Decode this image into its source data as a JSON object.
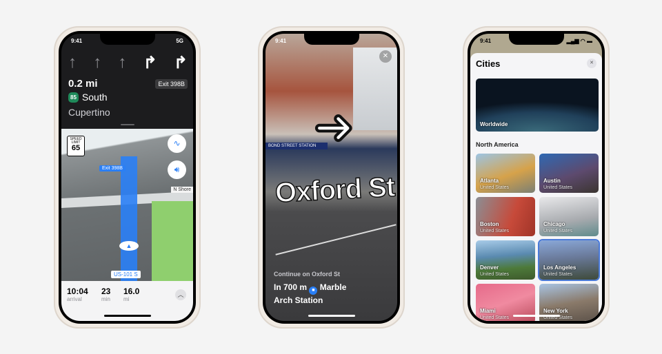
{
  "phone1": {
    "status": {
      "time": "9:41",
      "signal": "5G"
    },
    "lanes": [
      "↑",
      "↑",
      "↑",
      "↱",
      "↱"
    ],
    "distance": "0.2 mi",
    "exit_badge": "Exit 398B",
    "route_shield": "85",
    "direction": "South",
    "destination": "Cupertino",
    "speed_limit": {
      "label1": "SPEED",
      "label2": "LIMIT",
      "value": "65"
    },
    "map_labels": {
      "exit": "Exit 398B",
      "street": "N Shore",
      "highway": "US-101 S"
    },
    "trip": {
      "arrival": "10:04",
      "arrival_label": "arrival",
      "minutes": "23",
      "minutes_label": "min",
      "miles": "16.0",
      "miles_label": "mi"
    },
    "accent": "#2a7ff6"
  },
  "phone2": {
    "status": {
      "time": "9:41"
    },
    "sign": "BOND STREET STATION",
    "ar_street": "Oxford St",
    "instruction": "Continue on Oxford St",
    "line1_a": "In 700 m",
    "line1_b": "Marble",
    "line2": "Arch Station"
  },
  "phone3": {
    "status": {
      "time": "9:41"
    },
    "title": "Cities",
    "featured": "Worldwide",
    "section": "North America",
    "cities": [
      {
        "name": "Atlanta",
        "country": "United States",
        "bg": "linear-gradient(160deg,#9cc4e4,#d6a24a 55%,#7a7f74)"
      },
      {
        "name": "Austin",
        "country": "United States",
        "bg": "linear-gradient(160deg,#2f69b3,#5d4a6e 55%,#3b3530)"
      },
      {
        "name": "Boston",
        "country": "United States",
        "bg": "linear-gradient(110deg,#8b8e94,#c74a3a 60%,#a03428)"
      },
      {
        "name": "Chicago",
        "country": "United States",
        "bg": "linear-gradient(170deg,#e8e8ea,#a7aaae 60%,#5f8b8c)"
      },
      {
        "name": "Denver",
        "country": "United States",
        "bg": "linear-gradient(175deg,#a8cbe8,#5a8ab0 40%,#4d7a3a 70%,#3e5a2c)"
      },
      {
        "name": "Los Angeles",
        "country": "United States",
        "bg": "linear-gradient(175deg,#8aa8d8,#6a7a9a 45%,#3e4a3a)"
      },
      {
        "name": "Miami",
        "country": "United States",
        "bg": "linear-gradient(160deg,#e66a8a,#f08aa0 50%,#b84a5a)"
      },
      {
        "name": "New York",
        "country": "United States",
        "bg": "linear-gradient(170deg,#a8c4e4,#8a7a6a 50%,#5a5048)"
      }
    ],
    "selected": "Los Angeles"
  }
}
